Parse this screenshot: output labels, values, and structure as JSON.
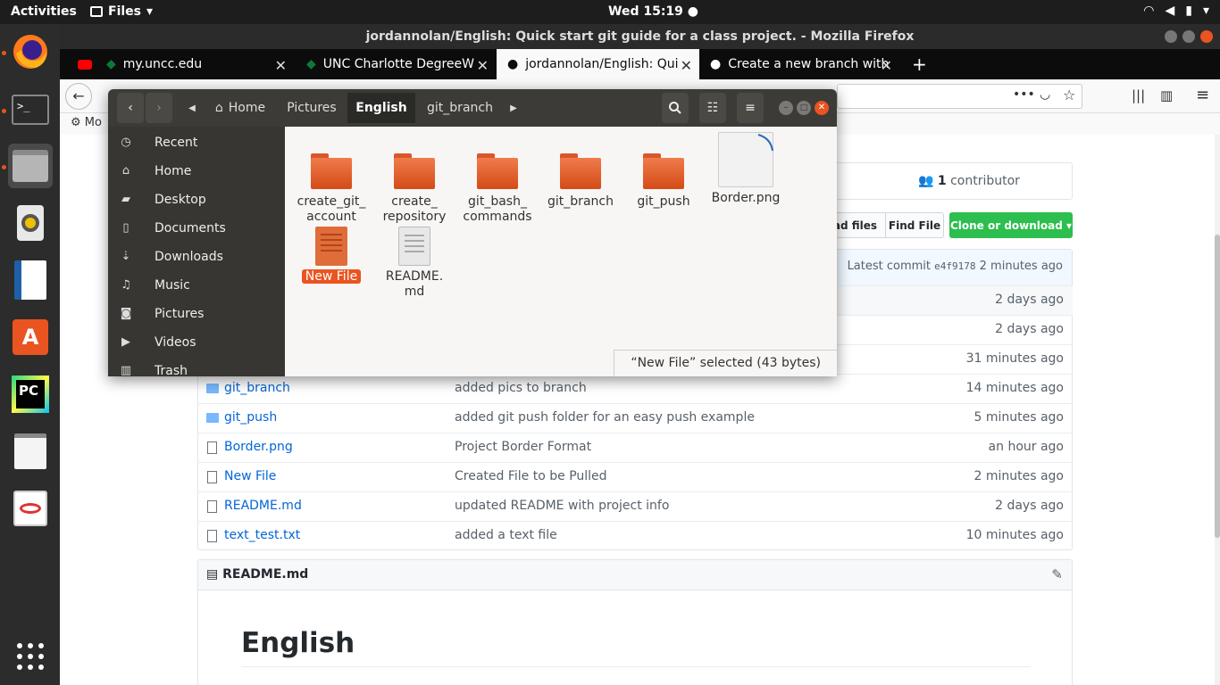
{
  "topbar": {
    "activities": "Activities",
    "app": "Files",
    "clock": "Wed 15:19"
  },
  "dock": {
    "icons": [
      "firefox-icon",
      "terminal-icon",
      "files-icon",
      "rhythmbox-icon",
      "writer-icon",
      "software-icon",
      "pycharm-icon",
      "text-editor-icon",
      "evince-icon",
      "app-grid-icon"
    ]
  },
  "firefox": {
    "title": "jordannolan/English: Quick start git guide for a class project. - Mozilla Firefox",
    "tabs": [
      {
        "label": "my.uncc.edu"
      },
      {
        "label": "UNC Charlotte DegreeW"
      },
      {
        "label": "jordannolan/English: Qui"
      },
      {
        "label": "Create a new branch with"
      }
    ],
    "new_tab": "+",
    "bookmark": "Mo"
  },
  "github": {
    "contributors": "1",
    "contributors_label": "contributor",
    "upload_btn": "ad files",
    "find_file_btn": "Find File",
    "clone_btn": "Clone or download ▾",
    "latest_commit_label": "Latest commit",
    "latest_commit_sha": "e4f9178",
    "latest_commit_age": "2 minutes ago",
    "rows": [
      {
        "name": "",
        "msg": "",
        "age": "2 days ago",
        "type": "dir"
      },
      {
        "name": "",
        "msg": "",
        "age": "2 days ago",
        "type": "dir"
      },
      {
        "name": "",
        "msg": "",
        "age": "31 minutes ago",
        "type": "dir"
      },
      {
        "name": "git_branch",
        "msg": "added pics to branch",
        "age": "14 minutes ago",
        "type": "dir"
      },
      {
        "name": "git_push",
        "msg": "added git push folder for an easy push example",
        "age": "5 minutes ago",
        "type": "dir"
      },
      {
        "name": "Border.png",
        "msg": "Project Border Format",
        "age": "an hour ago",
        "type": "file"
      },
      {
        "name": "New File",
        "msg": "Created File to be Pulled",
        "age": "2 minutes ago",
        "type": "file"
      },
      {
        "name": "README.md",
        "msg": "updated README with project info",
        "age": "2 days ago",
        "type": "file"
      },
      {
        "name": "text_test.txt",
        "msg": "added a text file",
        "age": "10 minutes ago",
        "type": "file"
      }
    ],
    "readme_title": "README.md",
    "readme_heading": "English"
  },
  "nautilus": {
    "breadcrumbs": [
      "Home",
      "Pictures",
      "English",
      "git_branch"
    ],
    "sidebar": [
      "Recent",
      "Home",
      "Desktop",
      "Documents",
      "Downloads",
      "Music",
      "Pictures",
      "Videos",
      "Trash"
    ],
    "files": [
      {
        "name": "create_git_\naccount",
        "kind": "folder"
      },
      {
        "name": "create_\nrepository",
        "kind": "folder"
      },
      {
        "name": "git_bash_\ncommands",
        "kind": "folder"
      },
      {
        "name": "git_branch",
        "kind": "folder"
      },
      {
        "name": "git_push",
        "kind": "folder"
      },
      {
        "name": "Border.png",
        "kind": "image"
      },
      {
        "name": "New File",
        "kind": "text-selected"
      },
      {
        "name": "README.\nmd",
        "kind": "text"
      }
    ],
    "status": "“New File” selected  (43 bytes)"
  }
}
